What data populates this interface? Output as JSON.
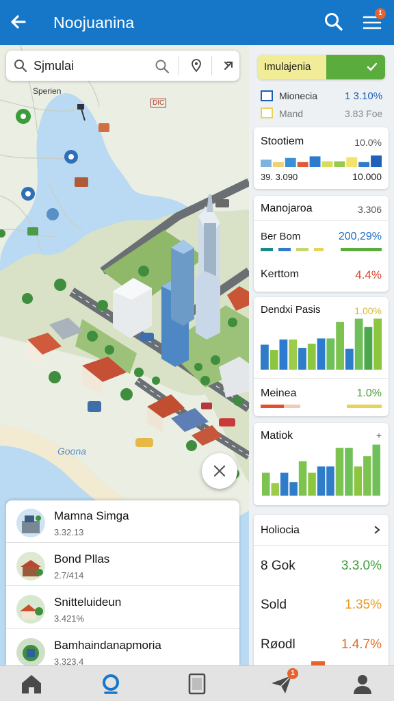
{
  "header": {
    "title": "Noojuanina",
    "notif_count": "1"
  },
  "search": {
    "value": "Sjmulai"
  },
  "map": {
    "labels": [
      "Sperien",
      "DIC",
      "Goona"
    ]
  },
  "places": [
    {
      "name": "Mamna Simga",
      "sub": "3.32.13"
    },
    {
      "name": "Bond Pllas",
      "sub": "2.7/414"
    },
    {
      "name": "Snitteluideun",
      "sub": "3.421%"
    },
    {
      "name": "Bamhaindanapmoria",
      "sub": "3.323.4"
    }
  ],
  "filter": {
    "label": "Imulajenia",
    "legend": [
      {
        "name": "Mionecia",
        "value": "1 3.10%",
        "color": "#1a5fb4"
      },
      {
        "name": "Mand",
        "value": "3.83 Foe",
        "color": "#e8d35a"
      }
    ]
  },
  "cards": {
    "station": {
      "title": "Stootiem",
      "pct": "10.0%",
      "left_val": "39. 3.090",
      "right_val": "10.000",
      "bars": [
        {
          "level": 0.45,
          "color": "#7eb3e0"
        },
        {
          "level": 0.3,
          "color": "#f0d070"
        },
        {
          "level": 0.55,
          "color": "#3b8fd6"
        },
        {
          "level": 0.3,
          "color": "#e05a3a"
        },
        {
          "level": 0.65,
          "color": "#2c7bd1"
        },
        {
          "level": 0.35,
          "color": "#d8dc5a"
        },
        {
          "level": 0.35,
          "color": "#9ac94f"
        },
        {
          "level": 0.6,
          "color": "#f1e36d"
        },
        {
          "level": 0.3,
          "color": "#2f7cc9"
        },
        {
          "level": 0.7,
          "color": "#1d62b8"
        }
      ]
    },
    "manojaroa": {
      "title": "Manojaroa",
      "value": "3.306",
      "row1_label": "Ber Bom",
      "row1_value": "200,29%",
      "row2_label": "Kerttom",
      "row2_value": "4.4%"
    },
    "dendi": {
      "title": "Dendxi Pasis",
      "value": "1.00%",
      "bars": [
        {
          "level": 0.48,
          "color": "#2f7cc9"
        },
        {
          "level": 0.38,
          "color": "#8cc63f"
        },
        {
          "level": 0.58,
          "color": "#2c7bd1"
        },
        {
          "level": 0.58,
          "color": "#9ccc4a"
        },
        {
          "level": 0.42,
          "color": "#2f7cc9"
        },
        {
          "level": 0.5,
          "color": "#8cc63f"
        },
        {
          "level": 0.6,
          "color": "#2c7bd1"
        },
        {
          "level": 0.6,
          "color": "#6fbf5a"
        },
        {
          "level": 0.92,
          "color": "#7cc34f"
        },
        {
          "level": 0.4,
          "color": "#2f7cc9"
        },
        {
          "level": 0.98,
          "color": "#6fbf5a"
        },
        {
          "level": 0.82,
          "color": "#4ba84d"
        },
        {
          "level": 0.98,
          "color": "#8cc63f"
        }
      ]
    },
    "meinea": {
      "title": "Meinea",
      "value": "1.0%"
    },
    "matiok": {
      "title": "Matiok",
      "value": "+",
      "bars": [
        {
          "level": 0.44,
          "color": "#7cc34f"
        },
        {
          "level": 0.24,
          "color": "#9ccc4a"
        },
        {
          "level": 0.44,
          "color": "#2f7cc9"
        },
        {
          "level": 0.26,
          "color": "#2f7cc9"
        },
        {
          "level": 0.66,
          "color": "#7cc34f"
        },
        {
          "level": 0.44,
          "color": "#8cc63f"
        },
        {
          "level": 0.56,
          "color": "#2f7cc9"
        },
        {
          "level": 0.56,
          "color": "#2f7cc9"
        },
        {
          "level": 0.92,
          "color": "#7cc34f"
        },
        {
          "level": 0.92,
          "color": "#6fbf5a"
        },
        {
          "level": 0.56,
          "color": "#8cc63f"
        },
        {
          "level": 0.76,
          "color": "#7cc34f"
        },
        {
          "level": 0.98,
          "color": "#6fbf5a"
        }
      ]
    },
    "holiocia": {
      "title": "Holiocia",
      "rows": [
        {
          "label": "8 Gok",
          "value": "3.3.0%",
          "color": "#3a9e3a"
        },
        {
          "label": "Sold",
          "value": "1.35%",
          "color": "#e89a26"
        },
        {
          "label": "Røodl",
          "value": "1.4.7%",
          "color": "#e36c1f"
        }
      ]
    }
  },
  "nav": {
    "badge": "1"
  }
}
